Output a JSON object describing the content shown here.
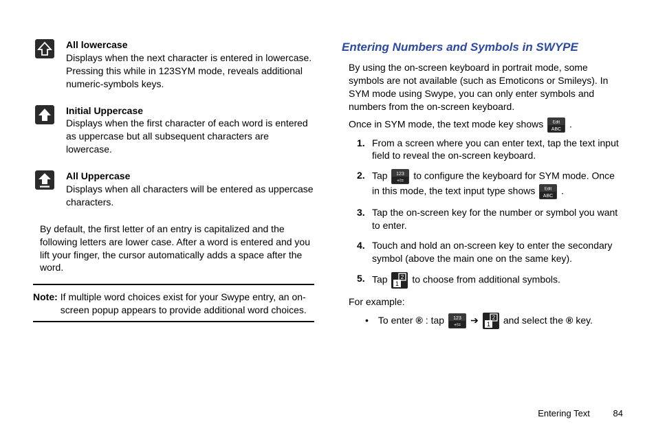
{
  "left": {
    "items": [
      {
        "title": "All lowercase",
        "desc": "Displays when the next character is entered in lowercase. Pressing this while in 123SYM mode, reveals additional numeric-symbols keys."
      },
      {
        "title": "Initial Uppercase",
        "desc": "Displays when the first character of each word is entered as uppercase but all subsequent characters are lowercase."
      },
      {
        "title": "All Uppercase",
        "desc": "Displays when all characters will be entered as uppercase characters."
      }
    ],
    "default_para": "By default, the first letter of an entry is capitalized and the following letters are lower case. After a word is entered and you lift your finger, the cursor automatically adds a space after the word.",
    "note_label": "Note:",
    "note_body": "If multiple word choices exist for your Swype entry, an on-screen popup appears to provide additional word choices."
  },
  "right": {
    "heading": "Entering Numbers and Symbols in SWYPE",
    "p1": "By using the on-screen keyboard in portrait mode, some symbols are not available (such as Emoticons or Smileys). In SYM mode using Swype, you can only enter symbols and numbers from the on-screen keyboard.",
    "p2a": "Once in SYM mode, the text mode key shows ",
    "p2b": ".",
    "steps": [
      "From a screen where you can enter text, tap the text input field to reveal the on-screen keyboard.",
      "Tap",
      "to configure the keyboard for SYM mode. Once in this mode, the text input type shows",
      ".",
      "Tap the on-screen key for the number or symbol you want to enter.",
      "Touch and hold an on-screen key to enter the secondary symbol (above the main one on the same key).",
      "Tap",
      "to choose from additional symbols."
    ],
    "example_label": "For example:",
    "bullet_a": "To enter",
    "bullet_b": ": tap",
    "bullet_arrow": "➔",
    "bullet_c": "and select the",
    "bullet_d": "key."
  },
  "footer": {
    "section": "Entering Text",
    "page": "84"
  },
  "icons": {
    "sym_top": "123",
    "sym_bot": "+!=",
    "edit_top": "Edit",
    "edit_bot": "ABC",
    "reg": "®"
  }
}
